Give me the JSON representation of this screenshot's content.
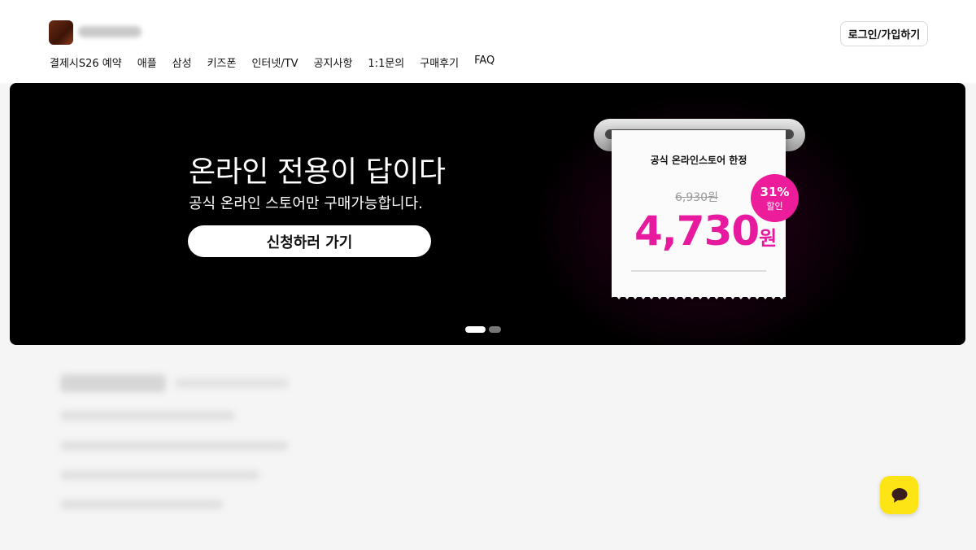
{
  "header": {
    "login_label": "로그인/가입하기"
  },
  "nav": {
    "items": [
      "결제시S26 예약",
      "애플",
      "삼성",
      "키즈폰",
      "인터넷/TV",
      "공지사항",
      "1:1문의",
      "구매후기",
      "FAQ"
    ]
  },
  "banner": {
    "headline": "온라인 전용이 답이다",
    "subline": "공식 온라인 스토어만 구매가능합니다.",
    "cta_label": "신청하러 가기",
    "receipt": {
      "title": "공식 온라인스토어 한정",
      "original_price": "6,930원",
      "sale_price": "4,730",
      "sale_unit": "원",
      "discount_percent": "31%",
      "discount_label": "할인"
    },
    "slides": {
      "count": 2,
      "active": 1
    },
    "accent_color": "#e6199f"
  },
  "chat": {
    "icon": "chat-bubble-icon",
    "color": "#fce415"
  }
}
